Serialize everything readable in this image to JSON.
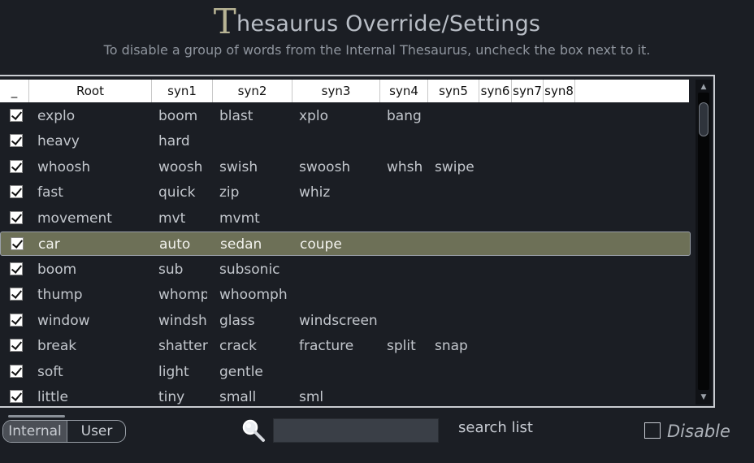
{
  "window": {
    "title_first_letter": "T",
    "title_rest": "hesaurus Override/Settings",
    "subtitle": "To disable a group of words from the Internal Thesaurus, uncheck the box next to it."
  },
  "table": {
    "columns": [
      "_",
      "Root",
      "syn1",
      "syn2",
      "syn3",
      "syn4",
      "syn5",
      "syn6",
      "syn7",
      "syn8"
    ],
    "selected_index": 5,
    "rows": [
      {
        "checked": true,
        "cells": [
          "explo",
          "boom",
          "blast",
          "xplo",
          "bang",
          "",
          "",
          "",
          ""
        ]
      },
      {
        "checked": true,
        "cells": [
          "heavy",
          "hard",
          "",
          "",
          "",
          "",
          "",
          "",
          ""
        ]
      },
      {
        "checked": true,
        "cells": [
          "whoosh",
          "woosh",
          "swish",
          "swoosh",
          "whsh",
          "swipe",
          "",
          "",
          ""
        ]
      },
      {
        "checked": true,
        "cells": [
          "fast",
          "quick",
          "zip",
          "whiz",
          "",
          "",
          "",
          "",
          ""
        ]
      },
      {
        "checked": true,
        "cells": [
          "movement",
          "mvt",
          "mvmt",
          "",
          "",
          "",
          "",
          "",
          ""
        ]
      },
      {
        "checked": true,
        "cells": [
          "car",
          "auto",
          "sedan",
          "coupe",
          "",
          "",
          "",
          "",
          ""
        ]
      },
      {
        "checked": true,
        "cells": [
          "boom",
          "sub",
          "subsonic",
          "",
          "",
          "",
          "",
          "",
          ""
        ]
      },
      {
        "checked": true,
        "cells": [
          "thump",
          "whomp",
          "whoomph",
          "",
          "",
          "",
          "",
          "",
          ""
        ]
      },
      {
        "checked": true,
        "cells": [
          "window",
          "windsh",
          "glass",
          "windscreen",
          "",
          "",
          "",
          "",
          ""
        ]
      },
      {
        "checked": true,
        "cells": [
          "break",
          "shatter",
          "crack",
          "fracture",
          "split",
          "snap",
          "",
          "",
          ""
        ]
      },
      {
        "checked": true,
        "cells": [
          "soft",
          "light",
          "gentle",
          "",
          "",
          "",
          "",
          "",
          ""
        ]
      },
      {
        "checked": true,
        "cells": [
          "little",
          "tiny",
          "small",
          "sml",
          "",
          "",
          "",
          "",
          ""
        ]
      }
    ]
  },
  "scrollbar": {
    "up_icon": "triangle-up-icon",
    "down_icon": "triangle-down-icon"
  },
  "footer": {
    "tab_internal": "Internal",
    "tab_user": "User",
    "active_tab": "Internal",
    "search_icon": "magnifier-icon",
    "search_value": "",
    "search_label": "search list",
    "disable_label": "Disable",
    "disable_checked": false
  },
  "colors": {
    "background": "#1b1e24",
    "selected_row": "#6d7057",
    "title_accent": "#b7b394"
  }
}
